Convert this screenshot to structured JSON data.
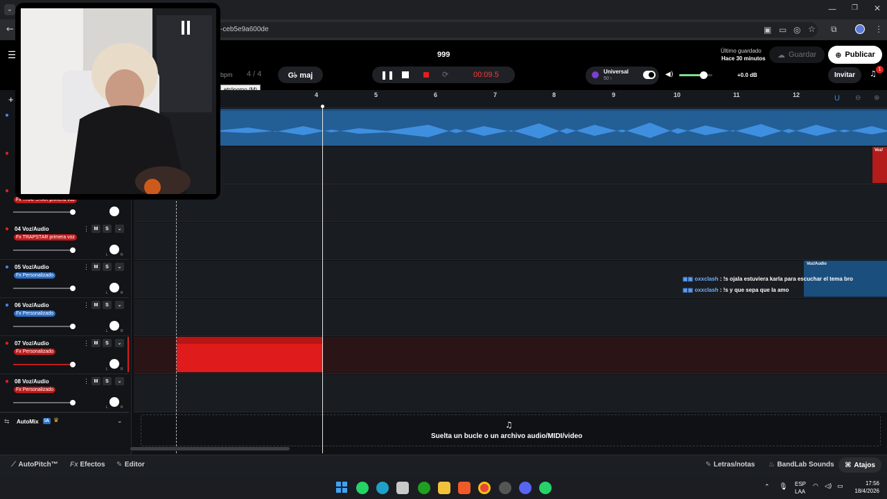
{
  "browser": {
    "url_fragment": "-ceb5e9a600de"
  },
  "header": {
    "project_title": "999",
    "last_saved_label": "Último guardado",
    "last_saved_time": "Hace 30 minutos",
    "save_label": "Guardar",
    "publish_label": "Publicar",
    "invite_label": "Invitar",
    "notification_count": "1"
  },
  "transport": {
    "bpm_label": "bpm",
    "time_sig": "4 / 4",
    "key_label": "G♭ maj",
    "time": "00:09.5",
    "metronome_tooltip": "etrónomo (M)"
  },
  "universal": {
    "label": "Universal",
    "value": "50 ›"
  },
  "volume": {
    "level_label": "+0.0 dB",
    "level": 0.72
  },
  "ruler": {
    "bars": [
      "4",
      "5",
      "6",
      "7",
      "8",
      "9",
      "10",
      "11",
      "12"
    ]
  },
  "tracks": [
    {
      "num": "04",
      "name": "Voz/Audio",
      "fx": "Fx TRAPSTAR primera voz",
      "fx_color": "red",
      "mic_color": "red"
    },
    {
      "num": "05",
      "name": "Voz/Audio",
      "fx": "Fx Personalizado",
      "fx_color": "blue",
      "mic_color": "blue"
    },
    {
      "num": "06",
      "name": "Voz/Audio",
      "fx": "Fx Personalizado",
      "fx_color": "blue",
      "mic_color": "blue"
    },
    {
      "num": "07",
      "name": "Voz/Audio",
      "fx": "Fx Personalizado",
      "fx_color": "red",
      "mic_color": "red"
    },
    {
      "num": "08",
      "name": "Voz/Audio",
      "fx": "Fx Personalizado",
      "fx_color": "red",
      "mic_color": "red"
    }
  ],
  "track03_fx": "Fx TRAPSTAR primera voz",
  "track_buttons": {
    "mute": "M",
    "solo": "S",
    "pan_l": "L",
    "pan_r": "R"
  },
  "automix": {
    "label": "AutoMix",
    "badge": "IA"
  },
  "dropzone": {
    "text": "Suelta un bucle o un archivo audio/MIDI/video"
  },
  "clip_labels": {
    "voz_audio": "Voz/Audio",
    "voz_short": "Voz/"
  },
  "chat": [
    {
      "user": "oxxclash",
      "message": ": !s ojala estuviera karla para escuchar el tema bro"
    },
    {
      "user": "oxxclash",
      "message": ": !s y que sepa que la amo"
    }
  ],
  "bottom_tabs": {
    "autopitch": "AutoPitch™",
    "effects": "Efectos",
    "editor": "Editor",
    "lyrics": "Letras/notas",
    "sounds": "BandLab Sounds",
    "shortcuts": "Atajos"
  },
  "taskbar": {
    "lang1": "ESP",
    "lang2": "LAA",
    "time": "17:56",
    "date": "18/4/2026"
  }
}
